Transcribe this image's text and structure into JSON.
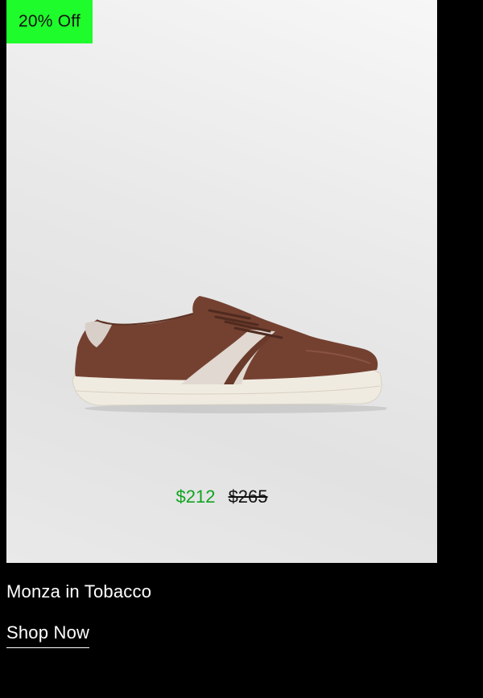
{
  "badge": {
    "text": "20% Off",
    "color": "#1ffc2c"
  },
  "product": {
    "image_icon": "sneaker-image",
    "name": "Monza in Tobacco",
    "sale_price": "$212",
    "original_price": "$265",
    "sale_price_color": "#10a321"
  },
  "cta": {
    "label": "Shop Now"
  }
}
